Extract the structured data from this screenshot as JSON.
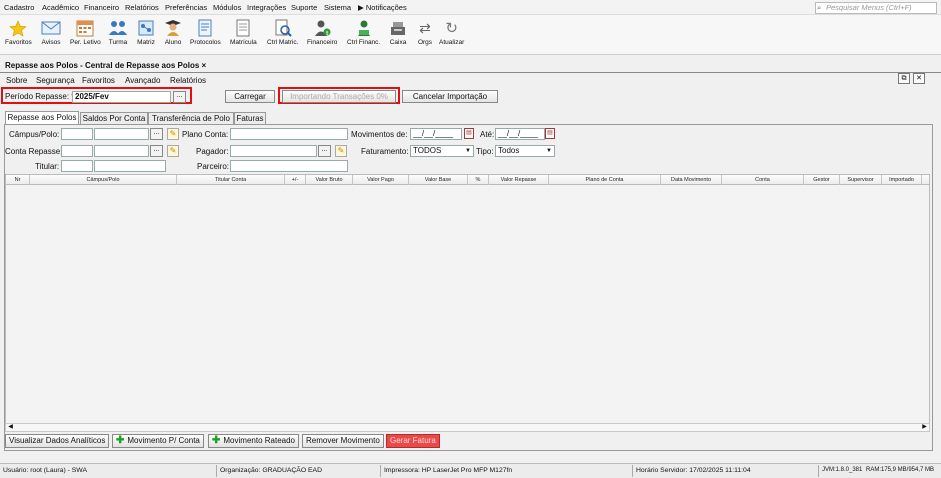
{
  "menubar": {
    "items": [
      "Cadastro",
      "Acadêmico",
      "Financeiro",
      "Relatórios",
      "Preferências",
      "Módulos",
      "Integrações",
      "Suporte",
      "Sistema",
      "Notificações"
    ],
    "search_placeholder": "Pesquisar Menus (Ctrl+F)"
  },
  "toolbar": {
    "items": [
      "Favoritos",
      "Avisos",
      "Per. Letivo",
      "Turma",
      "Matriz",
      "Aluno",
      "Protocolos",
      "Matrícula",
      "Ctrl Matric.",
      "Financeiro",
      "Ctrl Financ.",
      "Caixa",
      "Orgs",
      "Atualizar"
    ]
  },
  "window": {
    "title": "Repasse aos Polos - Central de Repasse aos Polos",
    "close": "×",
    "submenu": [
      "Sobre",
      "Segurança",
      "Favoritos",
      "Avançado",
      "Relatórios"
    ]
  },
  "periodo": {
    "label": "Período Repasse: *",
    "value": "2025/Fev",
    "lookup": "..."
  },
  "actions": {
    "carregar": "Carregar",
    "importando": "Importando Transações 0%",
    "cancelar": "Cancelar Importação"
  },
  "tabs": [
    "Repasse aos Polos",
    "Saldos Por Conta",
    "Transferência de Polo",
    "Faturas"
  ],
  "filters": {
    "campus_label": "Câmpus/Polo:",
    "conta_repasse_label": "Conta Repasse:",
    "titular_label": "Titular:",
    "plano_conta_label": "Plano Conta:",
    "pagador_label": "Pagador:",
    "parceiro_label": "Parceiro:",
    "movimentos_label": "Movimentos de:",
    "ate_label": "Até:",
    "date_placeholder": "__/__/____",
    "faturamento_label": "Faturamento:",
    "faturamento_value": "TODOS",
    "tipo_label": "Tipo:",
    "tipo_value": "Todos",
    "lookup": "..."
  },
  "grid": {
    "columns": [
      "Nr",
      "Câmpus/Polo",
      "Titular Conta",
      "+/-",
      "Valor Bruto",
      "Valor Pago",
      "Valor Base",
      "%",
      "Valor Repasse",
      "Plano de Conta",
      "Data Movimento",
      "Conta",
      "Gestor",
      "Supervisor",
      "Importado"
    ]
  },
  "bottom_buttons": {
    "visualizar": "Visualizar Dados Analíticos",
    "movimento_conta": "Movimento P/ Conta",
    "movimento_rateado": "Movimento Rateado",
    "remover": "Remover Movimento",
    "gerar_fatura": "Gerar Fatura"
  },
  "statusbar": {
    "usuario": "Usuário: root (Laura) - SWA",
    "organizacao": "Organização: GRADUAÇÃO EAD",
    "impressora": "Impressora: HP LaserJet Pro MFP M127fn",
    "horario": "Horário Servidor: 17/02/2025 11:11:04",
    "jvm": "JVM:1.8.0_381",
    "ram": "RAM:175,9 MB/954,7 MB"
  },
  "colors": {
    "highlight_border": "#e01010",
    "gerar_fatura_bg": "#e84a4a",
    "add_icon": "#19a319"
  }
}
